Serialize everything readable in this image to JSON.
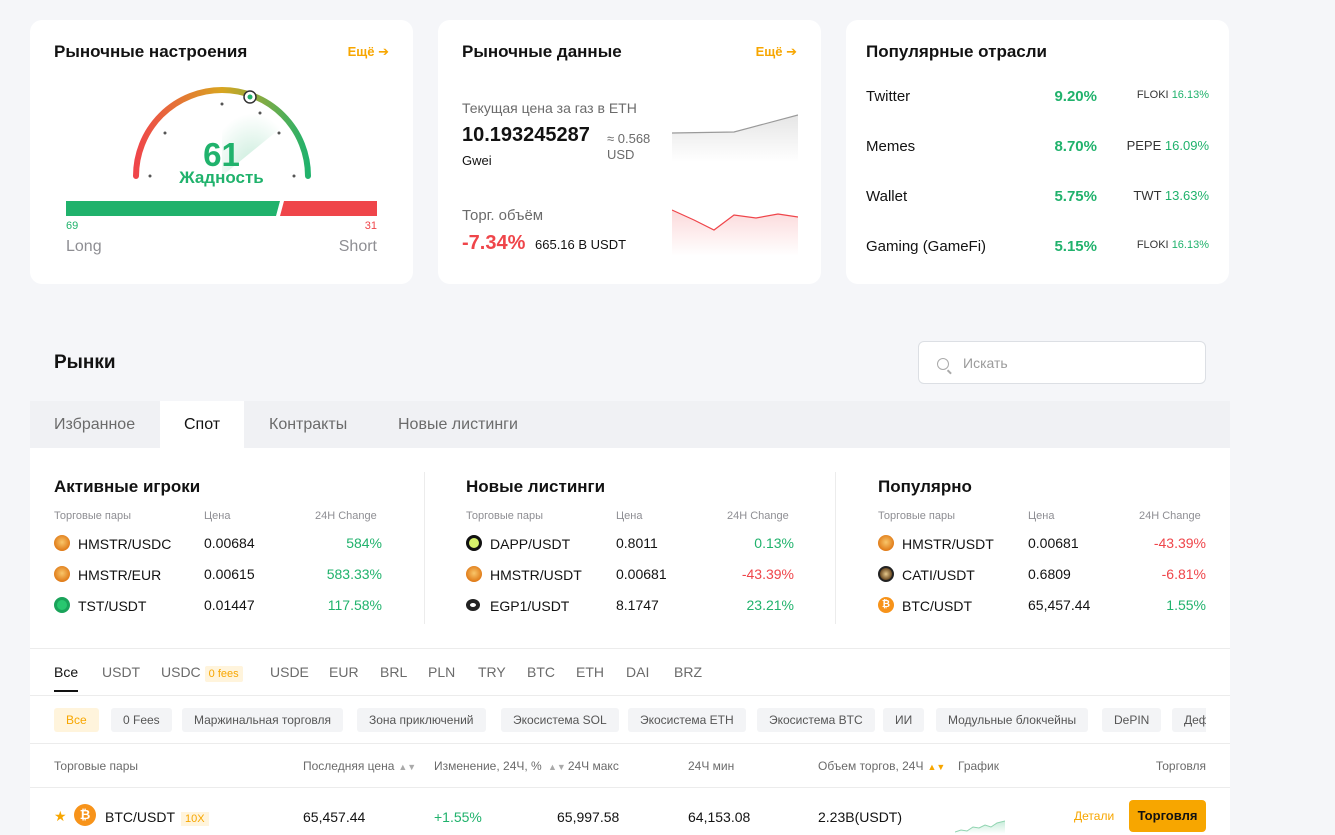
{
  "sentiment": {
    "title": "Рыночные настроения",
    "more": "Ещё",
    "value": "61",
    "label": "Жадность",
    "long_value": "69",
    "short_value": "31",
    "long_label": "Long",
    "short_label": "Short"
  },
  "market_data": {
    "title": "Рыночные данные",
    "more": "Ещё",
    "gas_label": "Текущая цена за газ в ETH",
    "gas_value": "10.193245287",
    "gas_unit": "Gwei",
    "gas_usd_line1": "≈ 0.568",
    "gas_usd_line2": "USD",
    "volume_label": "Торг. объём",
    "volume_change": "-7.34%",
    "volume_value": "665.16 B USDT"
  },
  "industries": {
    "title": "Популярные отрасли",
    "rows": [
      {
        "name": "Twitter",
        "pct": "9.20%",
        "coin": "FLOKI",
        "coin_pct": "16.13%"
      },
      {
        "name": "Memes",
        "pct": "8.70%",
        "coin": "PEPE",
        "coin_pct": "16.09%"
      },
      {
        "name": "Wallet",
        "pct": "5.75%",
        "coin": "TWT",
        "coin_pct": "13.63%"
      },
      {
        "name": "Gaming (GameFi)",
        "pct": "5.15%",
        "coin": "FLOKI",
        "coin_pct": "16.13%"
      }
    ]
  },
  "markets": {
    "title": "Рынки",
    "search_placeholder": "Искать",
    "tabs": [
      "Избранное",
      "Спот",
      "Контракты",
      "Новые листинги"
    ],
    "col_pairs": "Торговые пары",
    "col_price": "Цена",
    "col_change": "24H Change",
    "trending": [
      {
        "title": "Активные игроки",
        "rows": [
          {
            "pair": "HMSTR/USDC",
            "price": "0.00684",
            "change": "584%",
            "icon": "hmstr"
          },
          {
            "pair": "HMSTR/EUR",
            "price": "0.00615",
            "change": "583.33%",
            "icon": "hmstr"
          },
          {
            "pair": "TST/USDT",
            "price": "0.01447",
            "change": "117.58%",
            "icon": "tst"
          }
        ]
      },
      {
        "title": "Новые листинги",
        "rows": [
          {
            "pair": "DAPP/USDT",
            "price": "0.8011",
            "change": "0.13%",
            "icon": "dapp"
          },
          {
            "pair": "HMSTR/USDT",
            "price": "0.00681",
            "change": "-43.39%",
            "icon": "hmstr"
          },
          {
            "pair": "EGP1/USDT",
            "price": "8.1747",
            "change": "23.21%",
            "icon": "egp"
          }
        ]
      },
      {
        "title": "Популярно",
        "rows": [
          {
            "pair": "HMSTR/USDT",
            "price": "0.00681",
            "change": "-43.39%",
            "icon": "hmstr"
          },
          {
            "pair": "CATI/USDT",
            "price": "0.6809",
            "change": "-6.81%",
            "icon": "cati"
          },
          {
            "pair": "BTC/USDT",
            "price": "65,457.44",
            "change": "1.55%",
            "icon": "btc"
          }
        ]
      }
    ],
    "quote_tabs": [
      "Все",
      "USDT",
      "USDC",
      "USDE",
      "EUR",
      "BRL",
      "PLN",
      "TRY",
      "BTC",
      "ETH",
      "DAI",
      "BRZ"
    ],
    "usdc_badge": "0 fees",
    "chips": [
      "Все",
      "0 Fees",
      "Маржинальная торговля",
      "Зона приключений",
      "Экосистема SOL",
      "Экосистема ETH",
      "Экосистема BTC",
      "ИИ",
      "Модульные блокчейны",
      "DePIN",
      "Деф"
    ],
    "table_headers": {
      "pair": "Торговые пары",
      "last_price": "Последняя цена",
      "change": "Изменение, 24Ч, %",
      "high": "24Ч макс",
      "low": "24Ч мин",
      "volume": "Объем торгов, 24Ч",
      "chart": "График",
      "trade": "Торговля"
    },
    "rows": [
      {
        "base": "BTC",
        "quote": "/USDT",
        "leverage": "10X",
        "last_price": "65,457.44",
        "change": "+1.55%",
        "high": "65,997.58",
        "low": "64,153.08",
        "volume": "2.23B(USDT)",
        "details": "Детали",
        "trade": "Торговля"
      }
    ]
  },
  "colors": {
    "accent": "#f7a600",
    "up": "#20b26c",
    "down": "#ef454a"
  }
}
